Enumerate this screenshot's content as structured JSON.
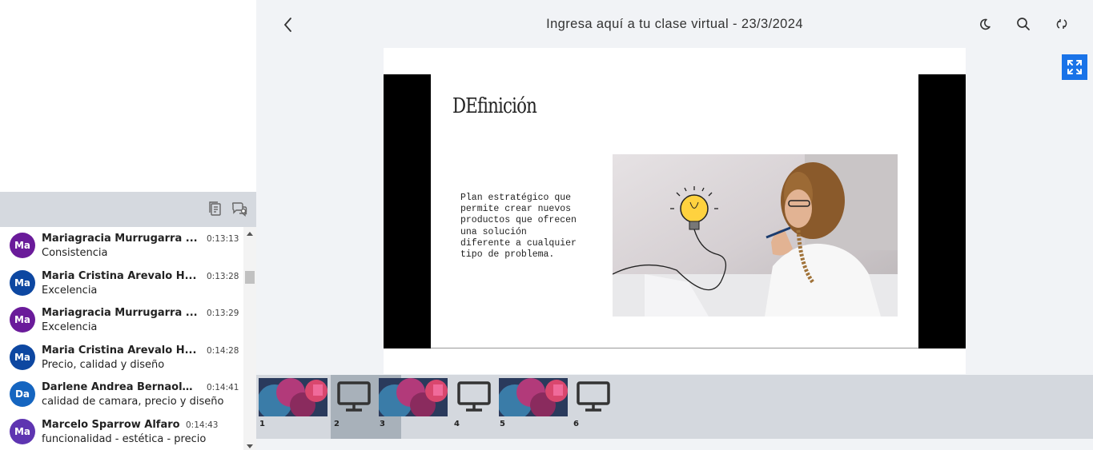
{
  "header": {
    "title": "Ingresa aquí a tu clase virtual - 23/3/2024"
  },
  "chat": {
    "messages": [
      {
        "initials": "Ma",
        "name": "Mariagracia Murrugarra ...",
        "time": "0:13:13",
        "text": "Consistencia",
        "color": "#6a1b9a"
      },
      {
        "initials": "Ma",
        "name": "Maria Cristina Arevalo H...",
        "time": "0:13:28",
        "text": "Excelencia",
        "color": "#0d47a1"
      },
      {
        "initials": "Ma",
        "name": "Mariagracia Murrugarra ...",
        "time": "0:13:29",
        "text": "Excelencia",
        "color": "#6a1b9a"
      },
      {
        "initials": "Ma",
        "name": "Maria Cristina Arevalo H...",
        "time": "0:14:28",
        "text": "Precio, calidad y diseño",
        "color": "#0d47a1"
      },
      {
        "initials": "Da",
        "name": "Darlene Andrea Bernaola...",
        "time": "0:14:41",
        "text": "calidad de camara, precio y diseño",
        "color": "#1565c0"
      },
      {
        "initials": "Ma",
        "name": "Marcelo Sparrow Alfaro",
        "time": "0:14:43",
        "text": "funcionalidad - estética - precio",
        "color": "#5e35b1"
      }
    ]
  },
  "slide": {
    "title": "DEfinición",
    "body": "Plan estratégico que\npermite crear nuevos\nproductos que ofrecen\nuna solución\ndiferente a cualquier\ntipo de problema."
  },
  "thumbnails": [
    {
      "num": "1",
      "kind": "image"
    },
    {
      "num": "2",
      "kind": "screen",
      "active": true
    },
    {
      "num": "3",
      "kind": "image"
    },
    {
      "num": "4",
      "kind": "screen"
    },
    {
      "num": "5",
      "kind": "image"
    },
    {
      "num": "6",
      "kind": "screen"
    }
  ],
  "colors": {
    "accent": "#1a73e8",
    "toolbar": "#d5d9df",
    "background": "#f1f3f6"
  }
}
